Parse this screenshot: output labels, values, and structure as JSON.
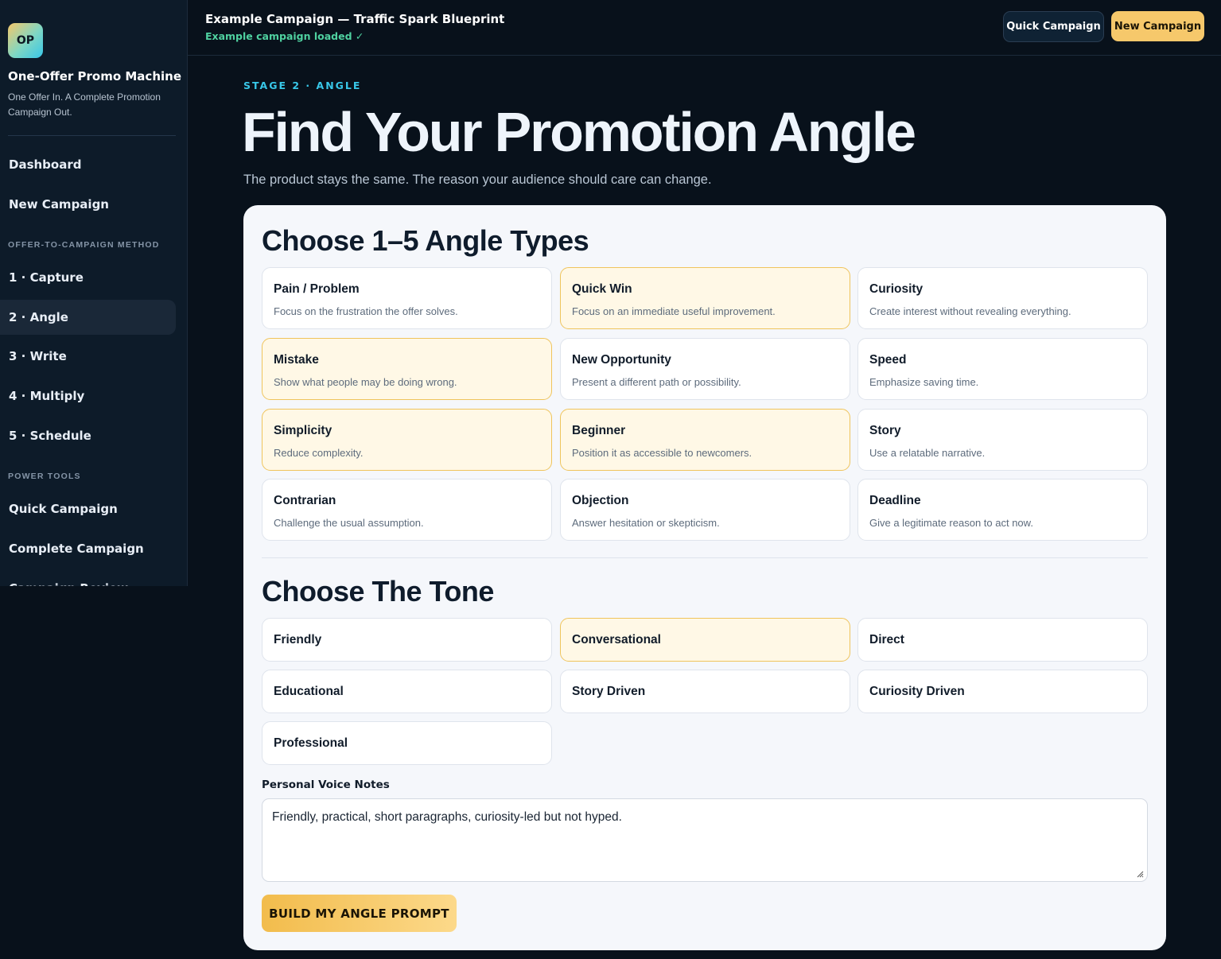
{
  "sidebar": {
    "logo_text": "OP",
    "app_title": "One-Offer Promo Machine",
    "app_tagline": "One Offer In. A Complete Promotion Campaign Out.",
    "nav_top": [
      {
        "label": "Dashboard"
      },
      {
        "label": "New Campaign"
      }
    ],
    "section_method": "OFFER-TO-CAMPAIGN METHOD",
    "method_items": [
      {
        "label": "1 · Capture"
      },
      {
        "label": "2 · Angle",
        "active": true
      },
      {
        "label": "3 · Write"
      },
      {
        "label": "4 · Multiply"
      },
      {
        "label": "5 · Schedule"
      }
    ],
    "section_tools": "POWER TOOLS",
    "tool_items": [
      {
        "label": "Quick Campaign"
      },
      {
        "label": "Complete Campaign"
      },
      {
        "label": "Campaign Review"
      }
    ]
  },
  "header": {
    "campaign_title": "Example Campaign — Traffic Spark Blueprint",
    "campaign_status": "Example campaign loaded ✓",
    "quick_campaign_label": "Quick Campaign",
    "new_campaign_label": "New Campaign"
  },
  "main": {
    "stage_label": "STAGE 2 · ANGLE",
    "title": "Find Your Promotion Angle",
    "subtitle": "The product stays the same. The reason your audience should care can change.",
    "angles_title": "Choose 1–5 Angle Types",
    "angles": [
      {
        "title": "Pain / Problem",
        "desc": "Focus on the frustration the offer solves.",
        "selected": false
      },
      {
        "title": "Quick Win",
        "desc": "Focus on an immediate useful improvement.",
        "selected": true
      },
      {
        "title": "Curiosity",
        "desc": "Create interest without revealing everything.",
        "selected": false
      },
      {
        "title": "Mistake",
        "desc": "Show what people may be doing wrong.",
        "selected": true
      },
      {
        "title": "New Opportunity",
        "desc": "Present a different path or possibility.",
        "selected": false
      },
      {
        "title": "Speed",
        "desc": "Emphasize saving time.",
        "selected": false
      },
      {
        "title": "Simplicity",
        "desc": "Reduce complexity.",
        "selected": true
      },
      {
        "title": "Beginner",
        "desc": "Position it as accessible to newcomers.",
        "selected": true
      },
      {
        "title": "Story",
        "desc": "Use a relatable narrative.",
        "selected": false
      },
      {
        "title": "Contrarian",
        "desc": "Challenge the usual assumption.",
        "selected": false
      },
      {
        "title": "Objection",
        "desc": "Answer hesitation or skepticism.",
        "selected": false
      },
      {
        "title": "Deadline",
        "desc": "Give a legitimate reason to act now.",
        "selected": false
      }
    ],
    "tone_title": "Choose The Tone",
    "tones": [
      {
        "title": "Friendly",
        "selected": false
      },
      {
        "title": "Conversational",
        "selected": true
      },
      {
        "title": "Direct",
        "selected": false
      },
      {
        "title": "Educational",
        "selected": false
      },
      {
        "title": "Story Driven",
        "selected": false
      },
      {
        "title": "Curiosity Driven",
        "selected": false
      },
      {
        "title": "Professional",
        "selected": false
      }
    ],
    "notes_label": "Personal Voice Notes",
    "notes_value": "Friendly, practical, short paragraphs, curiosity-led but not hyped.",
    "build_button": "BUILD MY ANGLE PROMPT"
  },
  "colors": {
    "accent_gold": "#f6c86b",
    "accent_cyan": "#38c7e8",
    "status_green": "#4fd1a0",
    "selected_bg": "#fff8e6",
    "selected_border": "#efc45c"
  }
}
